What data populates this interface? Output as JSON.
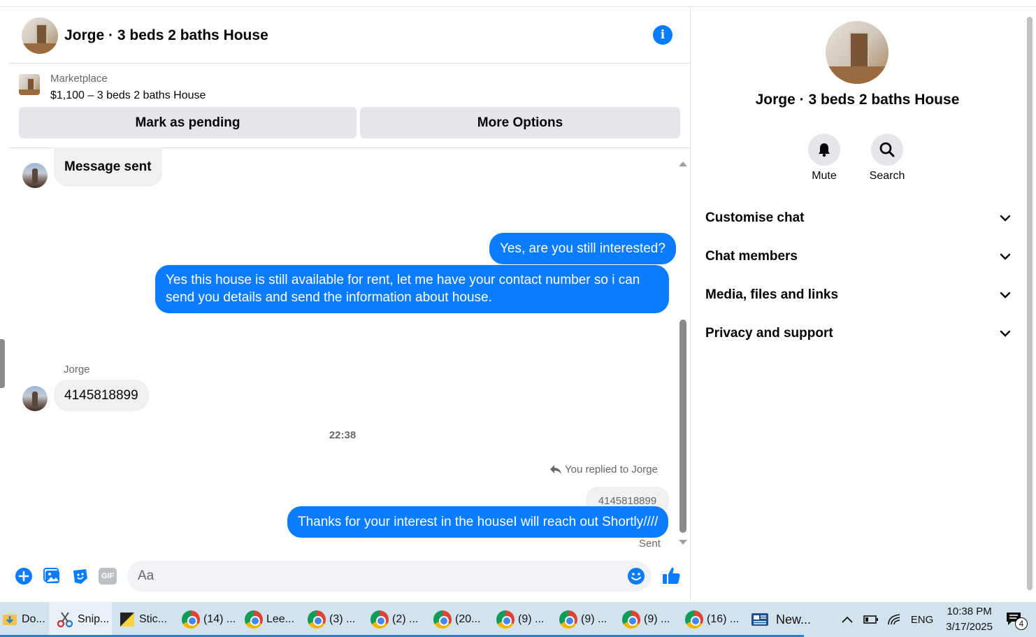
{
  "chat": {
    "title": "Jorge · 3 beds 2 baths House",
    "marketplace": {
      "label": "Marketplace",
      "listing": "$1,100 – 3 beds 2 baths House",
      "mark_pending": "Mark as pending",
      "more_options": "More Options"
    },
    "messages": {
      "m1": "Message sent",
      "m2": "Yes, are you still interested?",
      "m3_line1": "Yes this house is still available for rent, let me have your contact number so i can",
      "m3_line2": "send you details and send the information about house.",
      "sender": "Jorge",
      "m4": "4145818899",
      "time": "22:38",
      "reply_note": "You replied to Jorge",
      "reply_quote": "4145818899",
      "m5": "Thanks for your interest in the houseI will reach out Shortly////",
      "status": "Sent"
    },
    "composer": {
      "placeholder": "Aa",
      "gif": "GIF"
    }
  },
  "panel": {
    "title": "Jorge · 3 beds 2 baths House",
    "mute": "Mute",
    "search": "Search",
    "sections": [
      "Customise chat",
      "Chat members",
      "Media, files and links",
      "Privacy and support"
    ]
  },
  "taskbar": {
    "items": [
      "Do...",
      "Snip...",
      "Stic...",
      "(14) ...",
      "Lee...",
      "(3) ...",
      "(2) ...",
      "(20...",
      "(9) ...",
      "(9) ...",
      "(9) ...",
      "(16) ...",
      "New..."
    ],
    "lang": "ENG",
    "time": "10:38 PM",
    "date": "3/17/2025",
    "notifications": "4"
  },
  "colors": {
    "accent": "#0a7cff",
    "bubble_in": "#f0f0f0",
    "taskbar": "#d3e3ed"
  }
}
